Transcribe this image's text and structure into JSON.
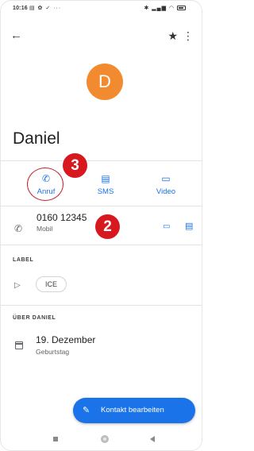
{
  "status_bar": {
    "time": "10:16",
    "left_icons": "▤ ✿ ✓ ···",
    "right_icons": "✱ ▂▄▆ ◠"
  },
  "top_bar": {
    "back_glyph": "←",
    "star_glyph": "★",
    "more_glyph": "⋮"
  },
  "contact": {
    "initial": "D",
    "name": "Daniel",
    "avatar_color": "#f28b30"
  },
  "actions": {
    "call_label": "Anruf",
    "sms_label": "SMS",
    "video_label": "Video",
    "call_glyph": "✆",
    "sms_glyph": "▤",
    "video_glyph": "▭"
  },
  "badges": {
    "step_call": "3",
    "step_phone": "2",
    "color": "#d7191f"
  },
  "phone": {
    "number": "0160 12345",
    "type": "Mobil",
    "icon_glyph": "✆",
    "video_glyph": "▭",
    "msg_glyph": "▤"
  },
  "label_section": {
    "title": "LABEL",
    "icon_glyph": "▷",
    "chip": "ICE"
  },
  "about_section": {
    "title": "ÜBER DANIEL",
    "birthday_date": "19. Dezember",
    "birthday_label": "Geburtstag"
  },
  "fab": {
    "label": "Kontakt bearbeiten",
    "icon_glyph": "✎",
    "color": "#1a73e8"
  },
  "accent_color": "#1a73e8"
}
